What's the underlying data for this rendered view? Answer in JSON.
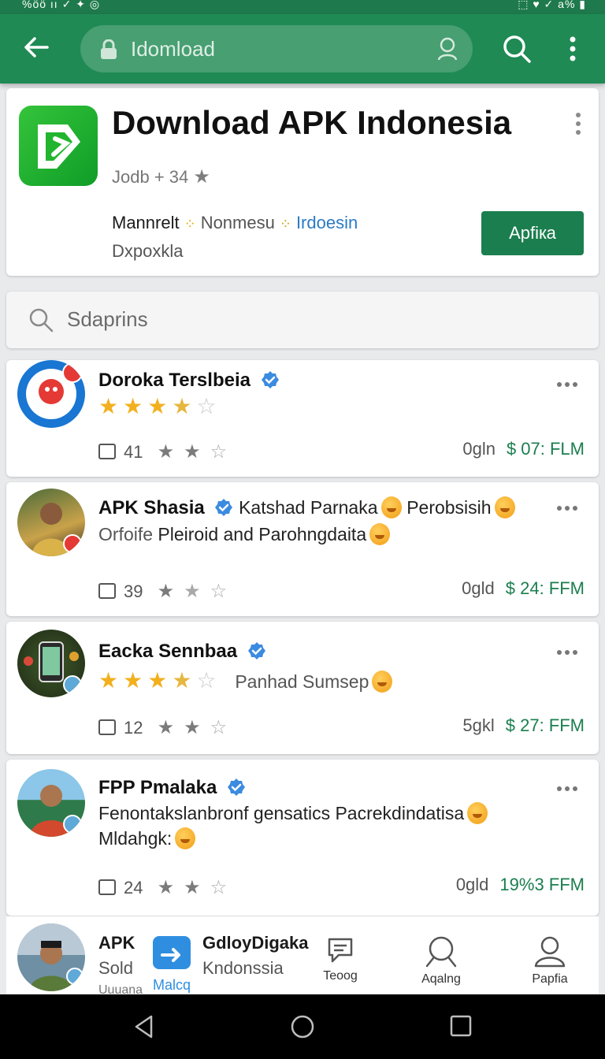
{
  "status_bar": {
    "left": "%öö ıı ✓ ✦ ◎",
    "right": "⬚ ♥ ✓ a% ▮"
  },
  "appbar": {
    "search_query": "Idomload"
  },
  "header": {
    "title": "Download APK Indonesia",
    "rating_text": "Jodb + 34",
    "meta": [
      "Mannrelt",
      "Nonmesu",
      "Irdoesin"
    ],
    "sub": "Dxpoxkla",
    "install_label": "Apfiкa",
    "logo_color": "#1fb32e"
  },
  "search": {
    "placeholder": "Sdaprins"
  },
  "items": [
    {
      "name": "Doroka Terslbeia",
      "rating": 3.5,
      "count": "41",
      "right_label": "0gln",
      "price": "$ 07: FLM"
    },
    {
      "name": "APK Shasia",
      "inline": "Katshad Parnaka",
      "inline2": "Perobsisih",
      "desc_first": "Orfoife",
      "desc_rest": "Pleiroid and Parohngdaita",
      "count": "39",
      "right_label": "0gld",
      "price": "$ 24: FFM"
    },
    {
      "name": "Eacka Sennbaa",
      "rating": 3.5,
      "rating_text": "Panhad Sumsep",
      "count": "12",
      "right_label": "5gkl",
      "price": "$ 27: FFM"
    },
    {
      "name": "FPP Pmalaka",
      "desc_line1": "Fenontakslanbronf gensatics Pacrekdindatisa",
      "desc_line2": "Mldahgk:",
      "count": "24",
      "right_label": "0gld",
      "price": "19%3 FFM"
    }
  ],
  "bottom_nav": {
    "entry_title": "APK",
    "entry_sub": "Sold",
    "entry_sub2": "Uuuana",
    "mail_label": "Malcq",
    "entry2_title": "GdloyDigaka",
    "entry2_sub": "Kndonssia",
    "tabs": [
      {
        "label": "Teoog",
        "icon": "chat-icon"
      },
      {
        "label": "Aqalng",
        "icon": "search-icon"
      },
      {
        "label": "Papfia",
        "icon": "person-icon"
      }
    ]
  },
  "colors": {
    "primary": "#1f8a54",
    "accent_green": "#1b7e4e",
    "star": "#f2b01e",
    "link_blue": "#2a7bc4"
  }
}
